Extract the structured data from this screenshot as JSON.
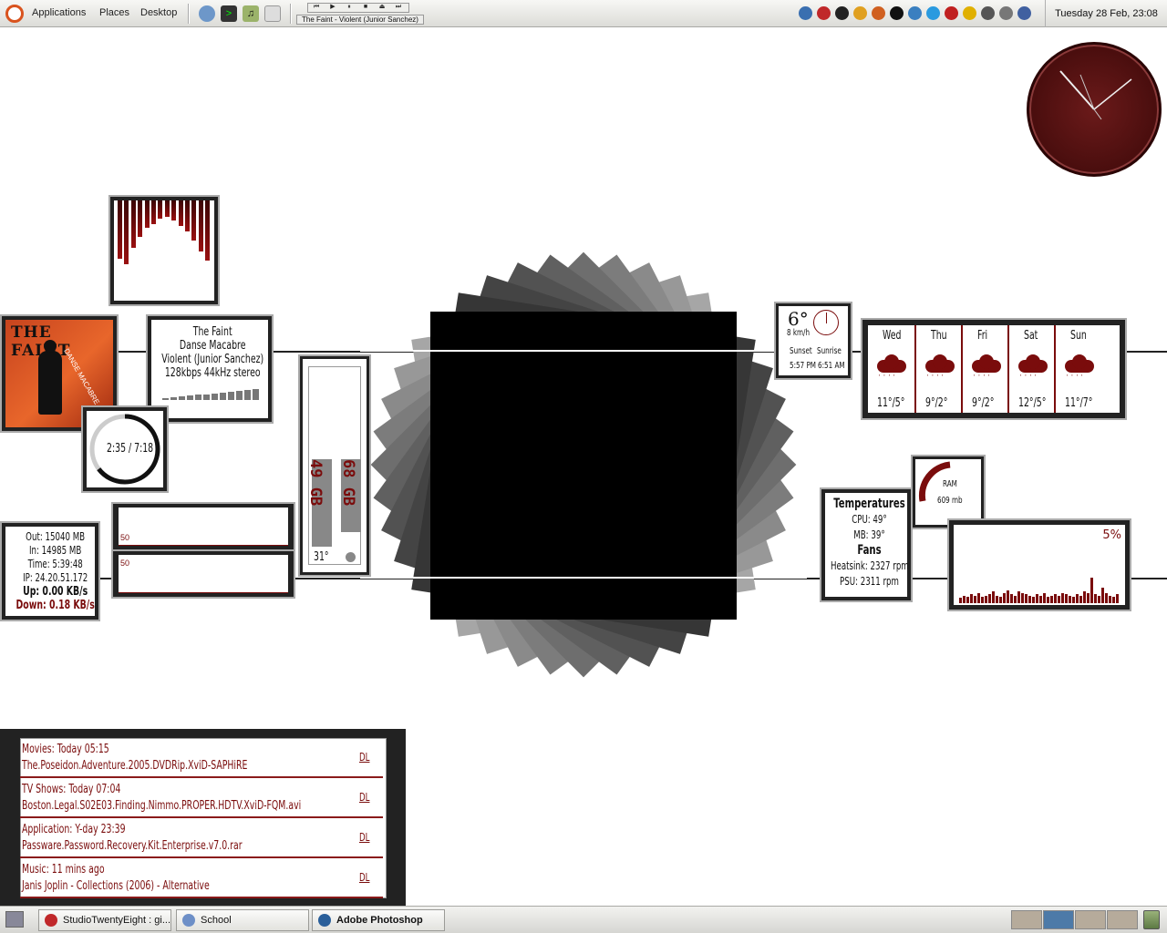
{
  "top_panel": {
    "menu_applications": "Applications",
    "menu_places": "Places",
    "menu_desktop": "Desktop",
    "now_playing_label": "The Faint - Violent (Junior Sanchez)",
    "clock": "Tuesday 28 Feb, 23:08",
    "tray_icons": [
      "network-icon",
      "opera-icon",
      "skype-icon",
      "pidgin-icon",
      "mail-icon",
      "winamp-icon",
      "firefox-icon",
      "ie-icon",
      "record-icon",
      "msn-icon",
      "volume-icon",
      "clipboard-icon",
      "display-icon"
    ]
  },
  "music": {
    "artist": "The Faint",
    "album": "Danse Macabre",
    "track": "Violent (Junior Sanchez)",
    "bitrate": "128kbps 44kHz stereo",
    "progress": "2:35 / 7:18",
    "progress_fraction": 0.354,
    "cover_title": "THE FAINT",
    "cover_subtitle": "DANSE MACABRE"
  },
  "network": {
    "out": "Out: 15040 MB",
    "in": "In: 14985 MB",
    "time": "Time: 5:39:48",
    "ip": "IP: 24.20.51.172",
    "up": "Up: 0.00 KB/s",
    "down": "Down: 0.18 KB/s",
    "graph1_label": "50",
    "graph2_label": "50"
  },
  "disk": {
    "disk1": "49 GB",
    "disk2": "68 GB",
    "temp": "31°"
  },
  "weather": {
    "current_temp": "6°",
    "wind": "8 km/h",
    "sunset_label": "Sunset",
    "sunrise_label": "Sunrise",
    "sunset": "5:57 PM",
    "sunrise": "6:51 AM",
    "days": [
      {
        "name": "Wed",
        "temps": "11°/5°"
      },
      {
        "name": "Thu",
        "temps": "9°/2°"
      },
      {
        "name": "Fri",
        "temps": "9°/2°"
      },
      {
        "name": "Sat",
        "temps": "12°/5°"
      },
      {
        "name": "Sun",
        "temps": "11°/7°"
      }
    ]
  },
  "system": {
    "temps_title": "Temperatures",
    "cpu": "CPU: 49°",
    "mb": "MB: 39°",
    "fans_title": "Fans",
    "heatsink": "Heatsink: 2327 rpm",
    "psu": "PSU: 2311 rpm",
    "ram_label": "RAM",
    "ram_value": "609 mb",
    "cpu_percent": "5%"
  },
  "downloads": [
    {
      "category": "Movies: Today 05:15",
      "file": "The.Poseidon.Adventure.2005.DVDRip.XviD-SAPHiRE",
      "link": "DL"
    },
    {
      "category": "TV Shows: Today 07:04",
      "file": "Boston.Legal.S02E03.Finding.Nimmo.PROPER.HDTV.XviD-FQM.avi",
      "link": "DL"
    },
    {
      "category": "Application: Y-day 23:39",
      "file": "Passware.Password.Recovery.Kit.Enterprise.v7.0.rar",
      "link": "DL"
    },
    {
      "category": "Music: 11 mins ago",
      "file": "Janis Joplin - Collections (2006) - Alternative",
      "link": "DL"
    }
  ],
  "taskbar": [
    {
      "label": "StudioTwentyEight : gi...",
      "icon": "opera-icon"
    },
    {
      "label": "School",
      "icon": "folder-icon"
    },
    {
      "label": "Adobe Photoshop",
      "icon": "photoshop-icon"
    }
  ],
  "colors": {
    "accent": "#7a0c0c",
    "frame": "#222222",
    "clock_face": "#5a1414"
  }
}
